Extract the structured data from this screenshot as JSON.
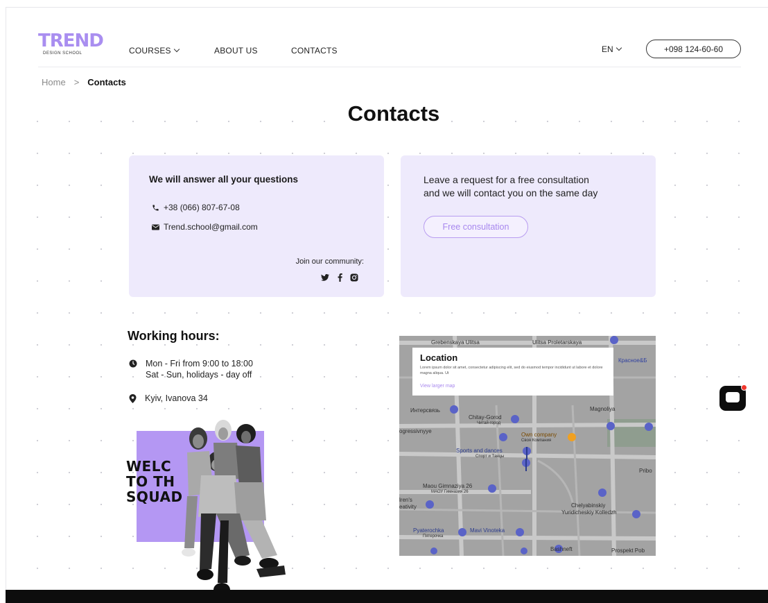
{
  "logo": {
    "main": "TREND",
    "sub": "DESIGN SCHOOL"
  },
  "nav": {
    "courses": "COURSES",
    "about": "ABOUT US",
    "contacts": "CONTACTS",
    "language": "EN",
    "phone": "+098 124-60-60"
  },
  "breadcrumb": {
    "home": "Home",
    "separator": ">",
    "current": "Contacts"
  },
  "page_title": "Contacts",
  "contact_card": {
    "heading": "We will answer all your questions",
    "phone": "+38 (066) 807-67-08",
    "email": "Trend.school@gmail.com",
    "join_label": "Join our community:",
    "socials": [
      "twitter-icon",
      "facebook-icon",
      "instagram-icon"
    ]
  },
  "request_card": {
    "line1": "Leave a request for a free consultation",
    "line2": "and we will contact you on the same day",
    "button": "Free consultation"
  },
  "working_hours": {
    "title": "Working hours:",
    "weekdays": "Mon - Fri from 9:00 to 18:00",
    "weekend": "Sat - Sun, holidays - day off",
    "address": "Kyiv, Ivanova 34"
  },
  "poster": {
    "line1": "WELC",
    "line2": "TO TH",
    "line3": "SQUAD"
  },
  "map": {
    "location_title": "Location",
    "location_desc": "Lorem ipsum dolor sit amet, consectetur adipiscing elit, sed do eiusmod tempor incididunt ut labore et dolore magna aliqua. Ut",
    "view_larger": "View larger map",
    "labels": {
      "l1": "Grebenskaya Ulitsa",
      "l2": "Ulitsa Proletarskaya",
      "l3": "Красное&Б",
      "l4": "Интерсвязь",
      "l5": "Chitay-Gorod",
      "l6": "Читай-город",
      "l7": "Magnoliya",
      "l8": "Own company",
      "l9": "Своя Компания",
      "l10": "Sports and dances",
      "l11": "Спорт и Танцы",
      "l12": "Maou Gimnaziya 26",
      "l13": "МАОУ Гимназия 26",
      "l14": "Chelyabinskiy",
      "l15": "Yuridicheskiy Kolledzh",
      "l16": "Pyaterochka",
      "l17": "Пятерочка",
      "l18": "Mavi Vinoteka",
      "l19": "Bashneft",
      "l20": "Prospekt Pob",
      "l21": "ogressivnyye",
      "l22": "lren's",
      "l23": "eativity",
      "l24": "Pribo"
    },
    "colors": {
      "background": "#a3a3a3",
      "road": "#c9c9c9",
      "pin": "#5a63c7",
      "orange_pin": "#f0a020"
    }
  },
  "colors": {
    "accent": "#a98ef0",
    "card_bg": "#eeeafc",
    "poster": "#b497f3",
    "chat_badge": "#f0362d"
  }
}
